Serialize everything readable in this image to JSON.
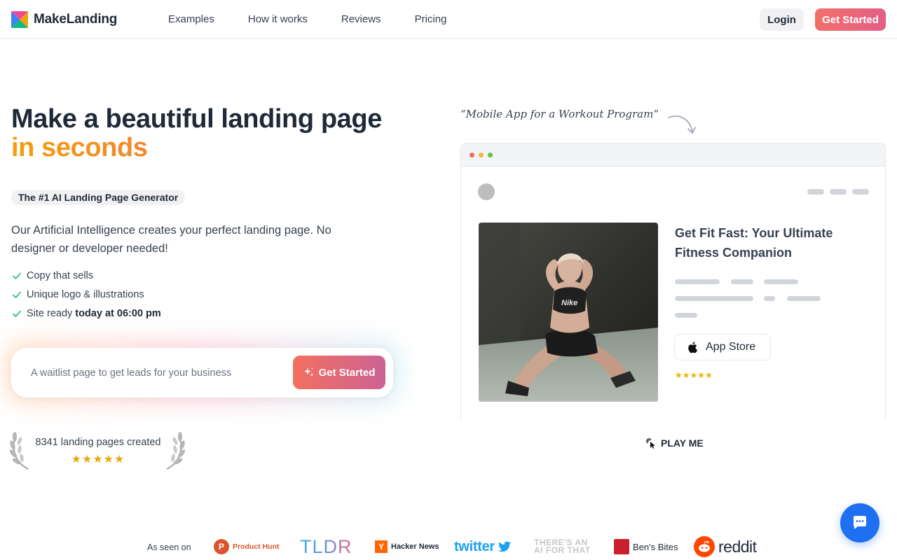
{
  "header": {
    "brand": "MakeLanding",
    "nav": [
      "Examples",
      "How it works",
      "Reviews",
      "Pricing"
    ],
    "login_label": "Login",
    "cta_label": "Get Started"
  },
  "hero": {
    "title_line1": "Make a beautiful landing page",
    "title_line2": "in seconds",
    "badge": "The #1 AI Landing Page Generator",
    "lead": "Our Artificial Intelligence creates your perfect landing page. No designer or developer needed!",
    "checks": [
      {
        "text": "Copy that sells",
        "bold": ""
      },
      {
        "text": "Unique logo & illustrations",
        "bold": ""
      },
      {
        "text": "Site ready",
        "bold": "today at 06:00 pm"
      }
    ],
    "prompt_placeholder": "A waitlist page to get leads for your business",
    "prompt_button": "Get Started",
    "count_text": "8341 landing pages created",
    "count_stars": "★★★★★"
  },
  "preview": {
    "quote": "“Mobile App for a Workout Program”",
    "title": "Get Fit Fast: Your Ultimate Fitness Companion",
    "app_store_label": "App Store",
    "stars": "★★★★★",
    "play_label": "PLAY ME",
    "photo_shirt_text": "Nike"
  },
  "seen_on": {
    "label": "As seen on",
    "product_hunt": "Product Hunt",
    "ph_letter": "P",
    "tldr": "TLDR",
    "hn_letter": "Y",
    "hacker_news": "Hacker News",
    "twitter": "twitter",
    "aift": "THERE'S AN AI FOR THAT",
    "bens_bites": "Ben's Bites",
    "reddit": "reddit"
  },
  "colors": {
    "accent_start": "#f26f6a",
    "accent_end": "#e35f86",
    "check": "#10b981",
    "star": "#e8a90e",
    "chat": "#1e6ff1"
  }
}
